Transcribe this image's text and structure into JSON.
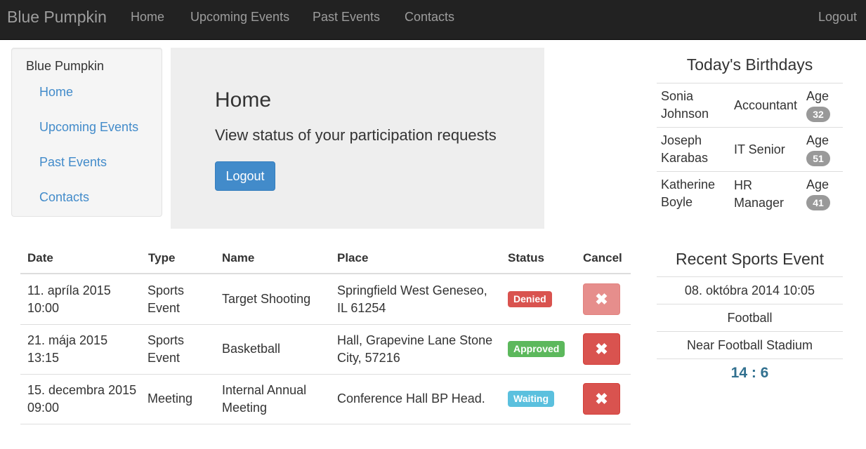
{
  "navbar": {
    "brand": "Blue Pumpkin",
    "links": [
      "Home",
      "Upcoming Events",
      "Past Events",
      "Contacts"
    ],
    "logout": "Logout"
  },
  "sidebar": {
    "title": "Blue Pumpkin",
    "items": [
      "Home",
      "Upcoming Events",
      "Past Events",
      "Contacts"
    ]
  },
  "jumbotron": {
    "title": "Home",
    "subtitle": "View status of your participation requests",
    "button": "Logout"
  },
  "events_table": {
    "headers": [
      "Date",
      "Type",
      "Name",
      "Place",
      "Status",
      "Cancel"
    ],
    "rows": [
      {
        "date": [
          "11. apríla 2015",
          "10:00"
        ],
        "type": [
          "Sports",
          "Event"
        ],
        "name": [
          "Target Shooting"
        ],
        "place": [
          "Springfield West Geneseo,",
          "IL 61254"
        ],
        "status": "Denied",
        "status_color": "#d9534f",
        "cancel_enabled": false
      },
      {
        "date": [
          "21. mája 2015",
          "13:15"
        ],
        "type": [
          "Sports",
          "Event"
        ],
        "name": [
          "Basketball"
        ],
        "place": [
          "Hall, Grapevine Lane Stone",
          "City, 57216"
        ],
        "status": "Approved",
        "status_color": "#5cb85c",
        "cancel_enabled": true
      },
      {
        "date": [
          "15. decembra 2015",
          "09:00"
        ],
        "type": [
          "Meeting"
        ],
        "name": [
          "Internal Annual",
          "Meeting"
        ],
        "place": [
          "Conference Hall BP Head."
        ],
        "status": "Waiting",
        "status_color": "#5bc0de",
        "cancel_enabled": true
      }
    ],
    "cancel_icon": "✖"
  },
  "birthdays": {
    "title": "Today's Birthdays",
    "age_label": "Age",
    "people": [
      {
        "name": [
          "Sonia",
          "Johnson"
        ],
        "role": [
          "Accountant"
        ],
        "age": "32"
      },
      {
        "name": [
          "Joseph",
          "Karabas"
        ],
        "role": [
          "IT Senior"
        ],
        "age": "51"
      },
      {
        "name": [
          "Katherine",
          "Boyle"
        ],
        "role": [
          "HR",
          "Manager"
        ],
        "age": "41"
      }
    ]
  },
  "sports": {
    "title": "Recent Sports Event",
    "date": "08. októbra 2014 10:05",
    "sport": "Football",
    "place": "Near Football Stadium",
    "score": "14 : 6"
  },
  "colors": {
    "primary": "#428bca",
    "danger": "#d9534f",
    "success": "#5cb85c",
    "info": "#5bc0de",
    "navbar": "#222222"
  }
}
